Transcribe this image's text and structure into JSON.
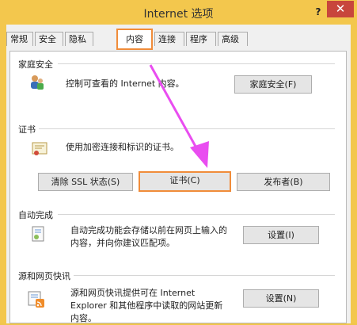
{
  "window": {
    "title": "Internet 选项",
    "help": "?",
    "close": "✕"
  },
  "tabs": [
    "常规",
    "安全",
    "隐私",
    "内容",
    "连接",
    "程序",
    "高级"
  ],
  "active_tab": "内容",
  "family_safety": {
    "label": "家庭安全",
    "desc": "控制可查看的 Internet 内容。",
    "button": "家庭安全(F)"
  },
  "certificates": {
    "label": "证书",
    "desc": "使用加密连接和标识的证书。",
    "clear_ssl": "清除 SSL 状态(S)",
    "certs": "证书(C)",
    "publishers": "发布者(B)"
  },
  "autocomplete": {
    "label": "自动完成",
    "desc_line1": "自动完成功能会存储以前在网页上输入的",
    "desc_line2": "内容，并向你建议匹配项。",
    "button": "设置(I)"
  },
  "feeds": {
    "label": "源和网页快讯",
    "desc_line1": "源和网页快讯提供可在 Internet",
    "desc_line2": "Explorer 和其他程序中读取的网站更新",
    "desc_line3": "内容。",
    "button": "设置(N)"
  },
  "colors": {
    "title_bg": "#f3c74d",
    "close_bg": "#c8463c",
    "highlight": "#f08c3a",
    "arrow": "#e94df0"
  }
}
